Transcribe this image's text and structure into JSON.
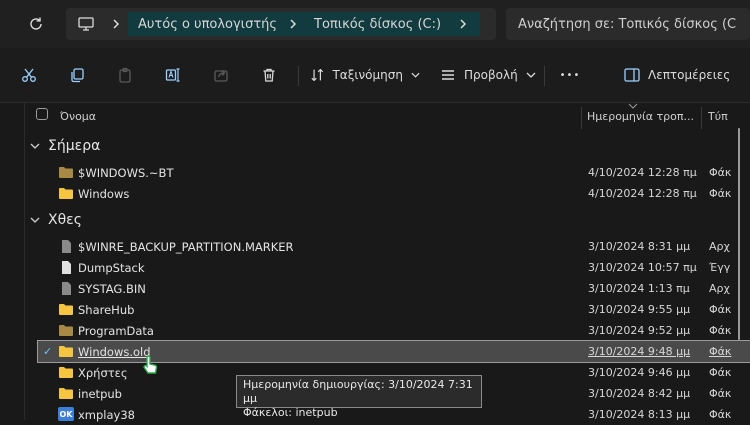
{
  "address": {
    "breadcrumbs": [
      "Αυτός ο υπολογιστής",
      "Τοπικός δίσκος (C:)"
    ]
  },
  "search": {
    "placeholder": "Αναζήτηση σε: Τοπικός δίσκος (C"
  },
  "toolbar": {
    "sort_label": "Ταξινόμηση",
    "view_label": "Προβολή",
    "more_label": "•••",
    "details_label": "Λεπτομέρειες"
  },
  "columns": {
    "name": "Όνομα",
    "date": "Ημερομηνία τροπ...",
    "type": "Τύπ"
  },
  "groups": {
    "today": "Σήμερα",
    "yesterday": "Χθες"
  },
  "files": [
    {
      "name": "$WINDOWS.~BT",
      "date": "4/10/2024 12:28 πμ",
      "type": "Φάκ",
      "icon": "folder-icon"
    },
    {
      "name": "Windows",
      "date": "4/10/2024 12:28 πμ",
      "type": "Φάκ",
      "icon": "folder-icon"
    },
    {
      "name": "$WINRE_BACKUP_PARTITION.MARKER",
      "date": "3/10/2024 8:31 μμ",
      "type": "Αρχ",
      "icon": "file-icon"
    },
    {
      "name": "DumpStack",
      "date": "3/10/2024 10:57 πμ",
      "type": "Έγγ",
      "icon": "file-icon"
    },
    {
      "name": "SYSTAG.BIN",
      "date": "3/10/2024 1:13 πμ",
      "type": "Αρχ",
      "icon": "file-icon"
    },
    {
      "name": "ShareHub",
      "date": "3/10/2024 9:55 μμ",
      "type": "Φάκ",
      "icon": "folder-icon"
    },
    {
      "name": "ProgramData",
      "date": "3/10/2024 9:52 μμ",
      "type": "Φάκ",
      "icon": "folder-icon"
    },
    {
      "name": "Windows.old",
      "date": "3/10/2024 9:48 μμ",
      "type": "Φάκ",
      "icon": "folder-icon"
    },
    {
      "name": "Χρήστες",
      "date": "3/10/2024 9:46 μμ",
      "type": "Φάκ",
      "icon": "folder-icon"
    },
    {
      "name": "inetpub",
      "date": "3/10/2024 8:42 μμ",
      "type": "Φάκ",
      "icon": "folder-icon"
    },
    {
      "name": "xmplay38",
      "date": "3/10/2024 8:13 μμ",
      "type": "Φάκ",
      "icon": "app-icon"
    }
  ],
  "app_icon_text": "OK",
  "tooltip": {
    "line1": "Ημερομηνία δημιουργίας: 3/10/2024 7:31 μμ",
    "line2": "Φάκελοι: inetpub"
  },
  "colors": {
    "accent": "#63c5ff",
    "breadcrumb_bg": "#113b3f",
    "folder": "#f5c542",
    "background": "#191919"
  }
}
